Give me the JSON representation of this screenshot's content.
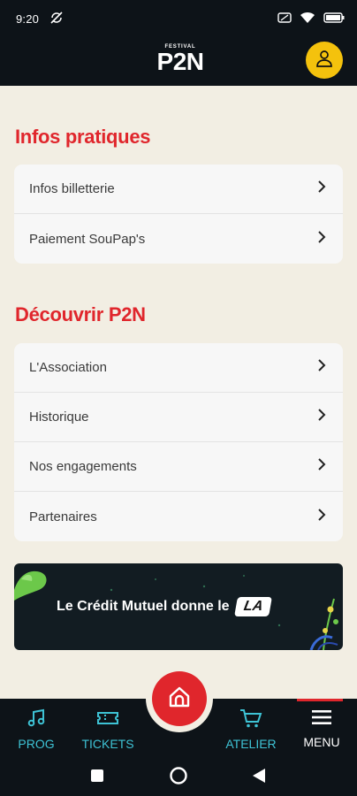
{
  "status": {
    "time": "9:20"
  },
  "header": {
    "logo_small": "FESTIVAL",
    "logo": "P2N"
  },
  "sections": [
    {
      "title": "Infos pratiques",
      "items": [
        "Infos billetterie",
        "Paiement SouPap's"
      ]
    },
    {
      "title": "Découvrir P2N",
      "items": [
        "L'Association",
        "Historique",
        "Nos engagements",
        "Partenaires"
      ]
    }
  ],
  "banner": {
    "text": "Le Crédit Mutuel donne le",
    "badge": "LA"
  },
  "tabs": [
    {
      "label": "PROG",
      "icon": "music-note-icon"
    },
    {
      "label": "TICKETS",
      "icon": "ticket-icon"
    },
    {
      "label": "ATELIER",
      "icon": "cart-icon"
    },
    {
      "label": "MENU",
      "icon": "hamburger-menu-icon"
    }
  ],
  "colors": {
    "accent_red": "#e0262c",
    "accent_teal": "#3ec3d5",
    "accent_yellow": "#f4c20d",
    "dark": "#0d1318",
    "background": "#f2eee3"
  }
}
